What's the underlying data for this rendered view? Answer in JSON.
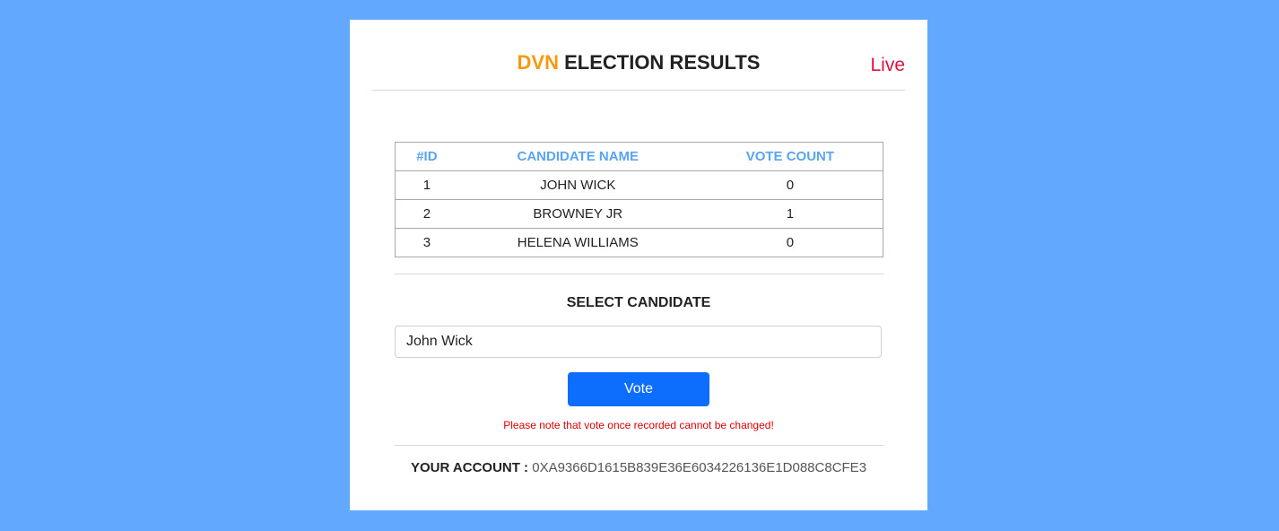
{
  "header": {
    "brand": "DVN",
    "title_rest": "ELECTION RESULTS",
    "status": "Live",
    "status_color": "#e0123d",
    "brand_color": "#f49a12"
  },
  "table": {
    "columns": [
      "#ID",
      "CANDIDATE NAME",
      "VOTE COUNT"
    ],
    "rows": [
      {
        "id": "1",
        "name": "JOHN WICK",
        "votes": "0"
      },
      {
        "id": "2",
        "name": "BROWNEY JR",
        "votes": "1"
      },
      {
        "id": "3",
        "name": "HELENA WILLIAMS",
        "votes": "0"
      }
    ],
    "header_color": "#5aa4f2"
  },
  "vote_form": {
    "label": "SELECT CANDIDATE",
    "selected": "John Wick",
    "button_label": "Vote",
    "button_color": "#0d6efd",
    "note": "Please note that vote once recorded cannot be changed!"
  },
  "account": {
    "label": "YOUR ACCOUNT :",
    "value": "0XA9366D1615B839E36E6034226136E1D088C8CFE3"
  },
  "colors": {
    "background": "#62a8fe"
  }
}
